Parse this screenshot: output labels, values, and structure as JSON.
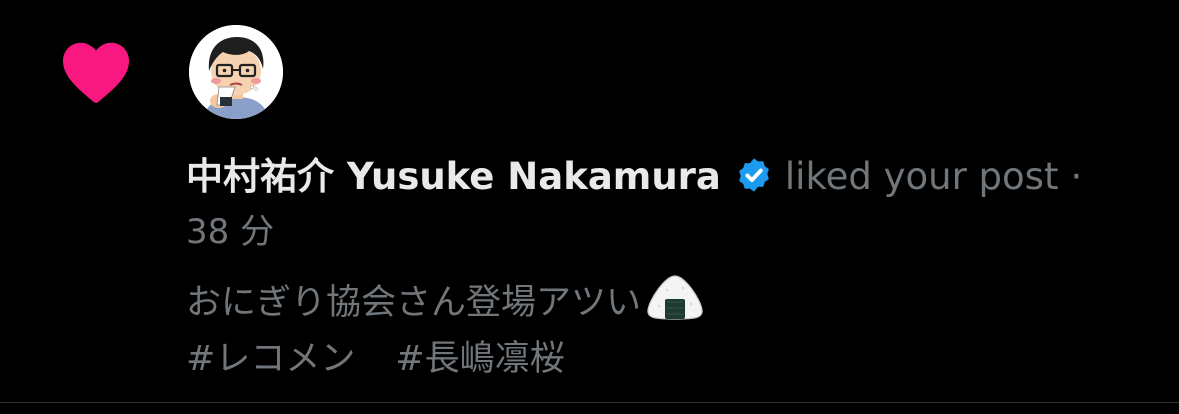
{
  "notification": {
    "type_icon": "heart-icon",
    "avatar_icon": "avatar-icon",
    "author_name": "中村祐介 Yusuke Nakamura",
    "verified_icon": "verified-badge-icon",
    "action": "liked your post",
    "separator": "·",
    "timestamp": "38 分",
    "post": {
      "text": "おにぎり協会さん登場アツい",
      "emoji_icon": "onigiri-emoji-icon",
      "hashtags": [
        "#レコメン",
        "#長嶋凛桜"
      ]
    }
  },
  "colors": {
    "background": "#000000",
    "heart": "#f91880",
    "verified": "#1d9bf0",
    "primary_text": "#e7e9ea",
    "secondary_text": "#71767b"
  }
}
